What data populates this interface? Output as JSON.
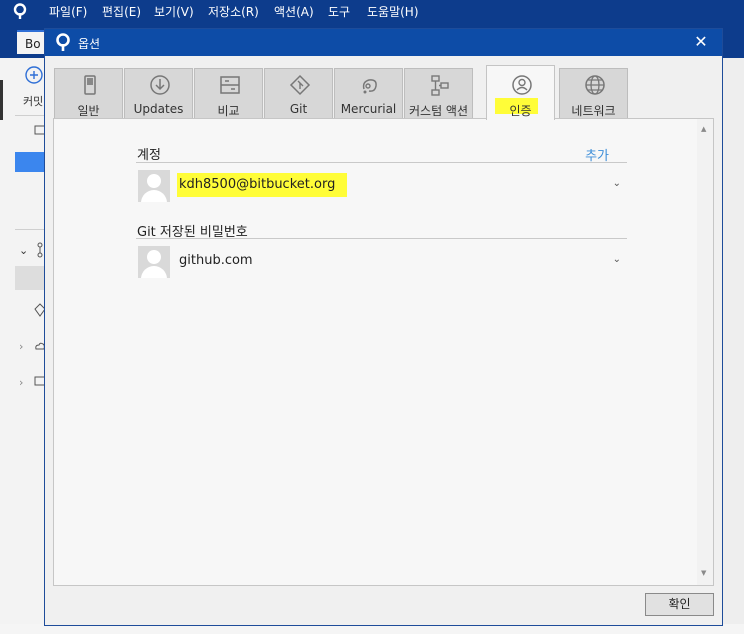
{
  "menubar": {
    "items": [
      "파일(F)",
      "편집(E)",
      "보기(V)",
      "저장소(R)",
      "액션(A)",
      "도구",
      "도움말(H)"
    ]
  },
  "background": {
    "tab_label": "Bo",
    "toolbar_label": "커밋"
  },
  "dialog": {
    "title": "옵션",
    "close_label": "✕",
    "tabs": [
      {
        "label": "일반",
        "icon": "toggle-icon"
      },
      {
        "label": "Updates",
        "icon": "download-icon"
      },
      {
        "label": "비교",
        "icon": "compare-icon"
      },
      {
        "label": "Git",
        "icon": "git-icon"
      },
      {
        "label": "Mercurial",
        "icon": "mercurial-icon"
      },
      {
        "label": "커스텀 액션",
        "icon": "custom-action-icon"
      },
      {
        "label": "인증",
        "icon": "user-circle-icon"
      },
      {
        "label": "네트워크",
        "icon": "globe-icon"
      }
    ],
    "active_tab": "인증",
    "accounts_section": {
      "title": "계정",
      "add_label": "추가",
      "accounts": [
        {
          "name": "kdh8500@bitbucket.org"
        }
      ]
    },
    "git_section": {
      "title": "Git 저장된 비밀번호",
      "entries": [
        {
          "name": "github.com"
        }
      ]
    },
    "ok_label": "확인"
  },
  "colors": {
    "title_bar": "#0d4ca7",
    "menubar": "#0d3c8c",
    "highlight": "#fffd38",
    "link": "#3d8ed8"
  }
}
